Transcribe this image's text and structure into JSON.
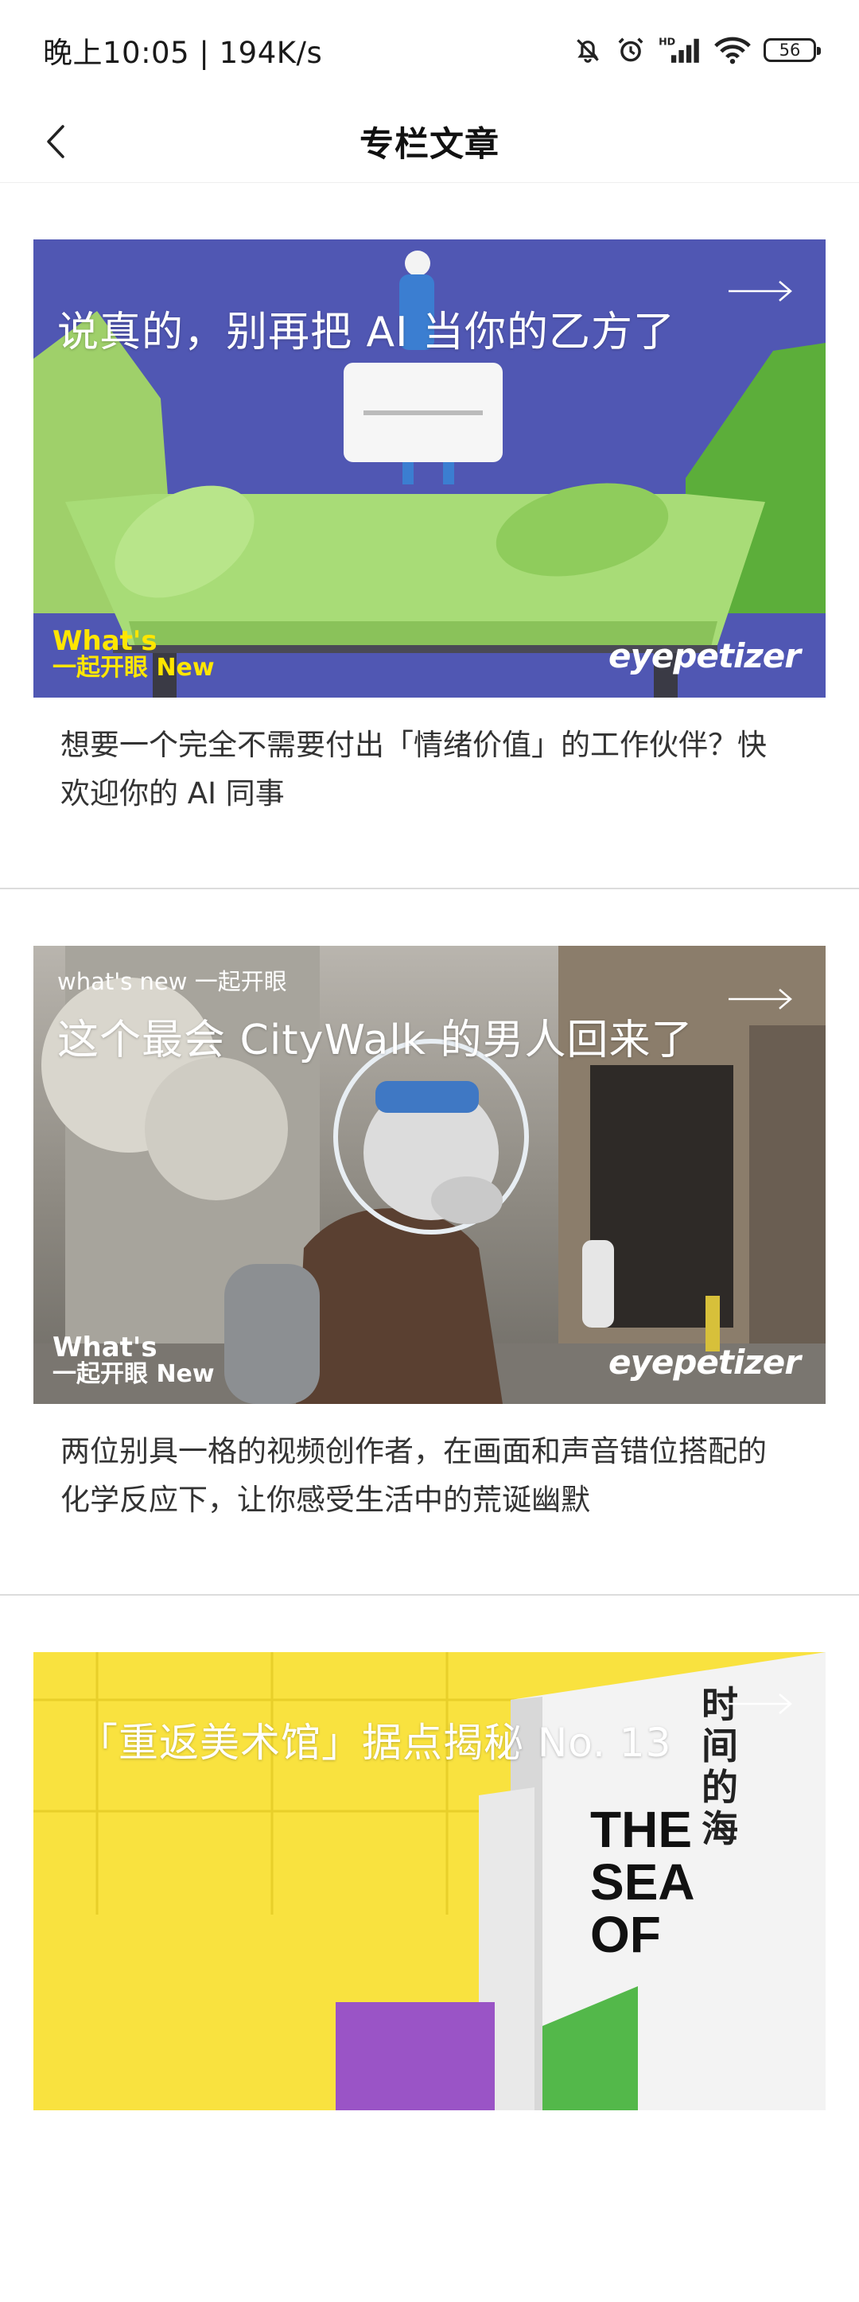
{
  "status_bar": {
    "time": "晚上10:05 | 194K/s",
    "battery": "56",
    "icons": [
      "mute-bell-icon",
      "alarm-icon",
      "hd-signal-icon",
      "wifi-icon",
      "battery-icon"
    ]
  },
  "nav": {
    "title": "专栏文章",
    "back_icon": "chevron-left-icon"
  },
  "articles": [
    {
      "image_title": "说真的，别再把 AI 当你的乙方了",
      "image_kicker": "",
      "badge_line1": "What's",
      "badge_line2": "一起开眼 New",
      "brand": "eyepetizer",
      "description": "想要一个完全不需要付出「情绪价值」的工作伙伴？快欢迎你的 AI 同事",
      "bg_color": "#5057b3"
    },
    {
      "image_title": "这个最会 CityWalk 的男人回来了",
      "image_kicker": "what's new 一起开眼",
      "badge_line1": "What's",
      "badge_line2": "一起开眼 New",
      "brand": "eyepetizer",
      "description": "两位别具一格的视频创作者，在画面和声音错位搭配的化学反应下，让你感受生活中的荒诞幽默",
      "bg_color": "#8a8880"
    },
    {
      "image_title": "「重返美术馆」据点揭秘 No. 13",
      "image_kicker": "",
      "poster_text_1": "THE SEA OF",
      "poster_text_2": "时间的海",
      "description": "",
      "bg_color": "#f9e23f"
    }
  ]
}
